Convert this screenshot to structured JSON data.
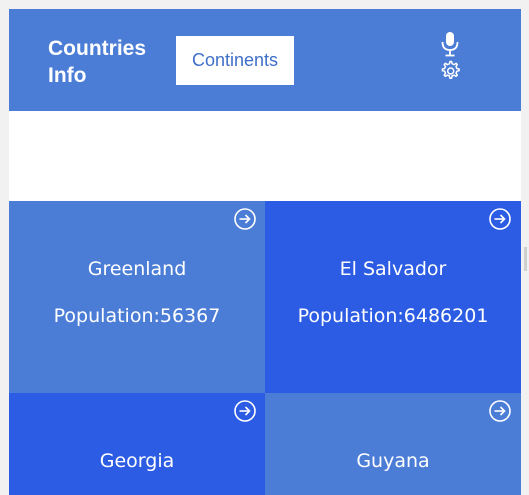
{
  "header": {
    "title": "Countries Info",
    "continents_label": "Continents",
    "mic_icon": "microphone-icon",
    "settings_icon": "gear-icon",
    "background": "#4b7dd6"
  },
  "countries": [
    {
      "name": "Greenland",
      "population": "Population:56367",
      "color": "#4b7dd6"
    },
    {
      "name": "El Salvador",
      "population": "Population:6486201",
      "color": "#2b5ce3"
    },
    {
      "name": "Georgia",
      "population": "",
      "color": "#2b5ce3"
    },
    {
      "name": "Guyana",
      "population": "",
      "color": "#4b7dd6"
    }
  ],
  "tile_icon": "arrow-right-circle-icon"
}
